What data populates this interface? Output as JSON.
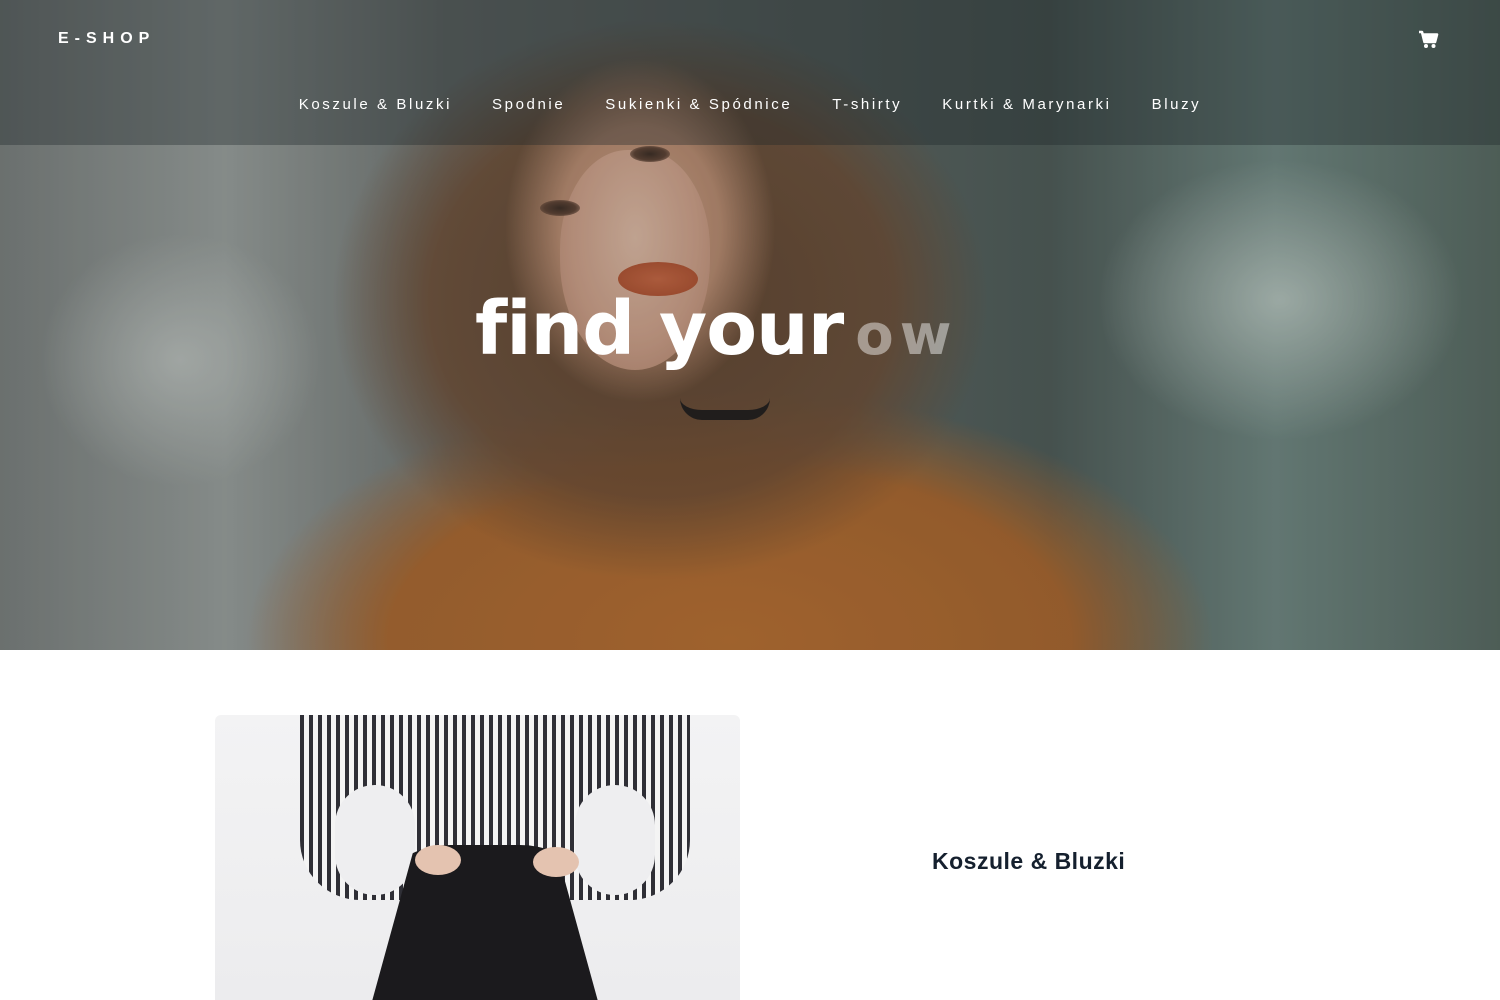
{
  "header": {
    "brand": "E-SHOP",
    "cart_icon": "shopping-cart-icon"
  },
  "nav": {
    "items": [
      {
        "label": "Koszule & Bluzki"
      },
      {
        "label": "Spodnie"
      },
      {
        "label": "Sukienki & Spódnice"
      },
      {
        "label": "T-shirty"
      },
      {
        "label": "Kurtki & Marynarki"
      },
      {
        "label": "Bluzy"
      }
    ]
  },
  "hero": {
    "slogan_main": "find your",
    "slogan_faded": "ow"
  },
  "featured": {
    "category_title": "Koszule & Bluzki"
  },
  "colors": {
    "nav_text": "#ffffff",
    "category_title": "#15202e",
    "accent_coat": "#b46a2c"
  }
}
